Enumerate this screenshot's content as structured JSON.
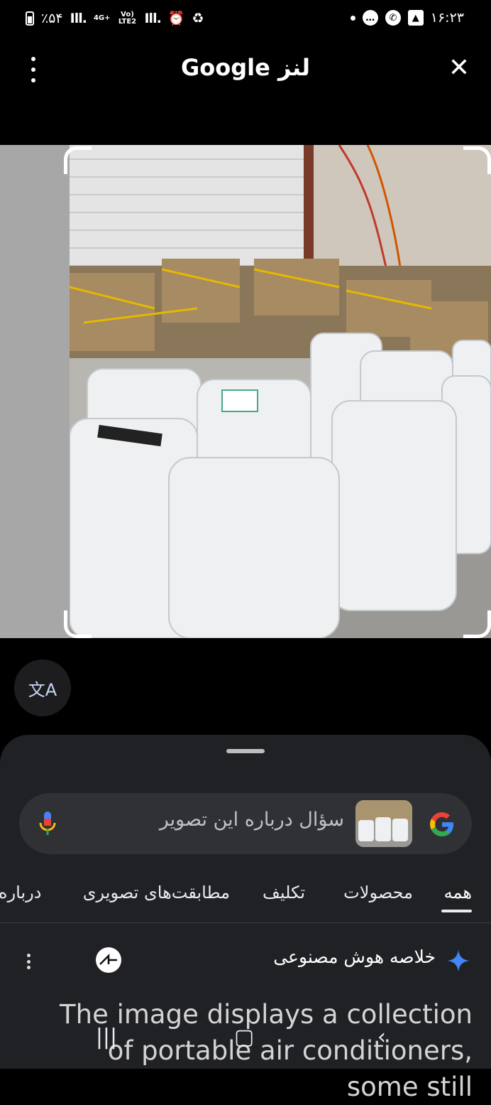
{
  "status_bar": {
    "battery": "٪۵۴",
    "network": "4G+",
    "volte": "Vo) LTE2",
    "time": "۱۶:۲۳"
  },
  "header": {
    "title": "Google لنز"
  },
  "search": {
    "placeholder": "سؤال درباره این تصویر"
  },
  "tabs": [
    {
      "label": "همه",
      "active": true
    },
    {
      "label": "محصولات"
    },
    {
      "label": "تکلیف"
    },
    {
      "label": "مطابقت‌های تصویری"
    },
    {
      "label": "درباره"
    }
  ],
  "ai_overview": {
    "title": "خلاصه هوش مصنوعی",
    "text": "The image displays a collection of portable air conditioners, some still"
  },
  "colors": {
    "sheet_bg": "#202124",
    "search_bg": "#303134",
    "google_blue": "#4285F4",
    "google_red": "#EA4335",
    "google_yellow": "#FBBC05",
    "google_green": "#34A853"
  }
}
